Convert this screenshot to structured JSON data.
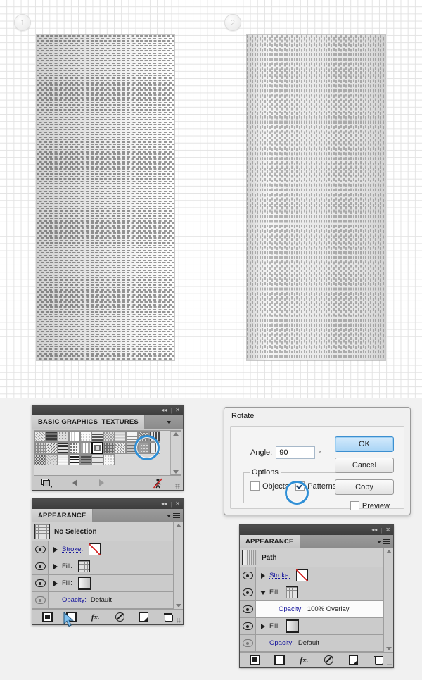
{
  "canvas": {
    "steps": [
      {
        "label": "1",
        "name": "step-badge-1"
      },
      {
        "label": "2",
        "name": "step-badge-2"
      }
    ],
    "artwork": [
      {
        "name": "artwork-original",
        "description": "rectangle filled with horizontal dash texture pattern"
      },
      {
        "name": "artwork-rotated",
        "description": "rectangle filled with dash texture pattern rotated 90 degrees"
      }
    ]
  },
  "swatch_panel": {
    "tab_label": "BASIC GRAPHICS_TEXTURES",
    "titlebar": {
      "collapse": "◂◂",
      "separator": "|",
      "close": "✕"
    },
    "menu_icon": "panel-menu-icon",
    "swatch_count": 29,
    "selected_swatch_index": 16,
    "footer": {
      "library_label": "swatch-libraries-menu",
      "prev_label": "load-previous-swatch-group",
      "next_label": "load-next-swatch-group",
      "break_link_label": "break-link-to-symbol"
    },
    "highlight": "selected pattern swatch ringed in blue"
  },
  "appearance_left": {
    "tab_label": "APPEARANCE",
    "titlebar": {
      "collapse": "◂◂",
      "separator": "|",
      "close": "✕"
    },
    "target_label": "No Selection",
    "rows": [
      {
        "label": "Stroke:",
        "value": "",
        "swatch": "none",
        "expandable": true,
        "visible": true
      },
      {
        "label": "Fill:",
        "value": "",
        "swatch": "pattern-grid",
        "expandable": true,
        "visible": true
      },
      {
        "label": "Fill:",
        "value": "",
        "swatch": "gradient",
        "expandable": true,
        "visible": true
      },
      {
        "label": "Opacity:",
        "value": "Default",
        "swatch": "",
        "expandable": false,
        "visible": true
      }
    ],
    "footer": {
      "add_stroke": "add-new-stroke",
      "add_fill": "add-new-fill",
      "effects": "fx",
      "clear": "clear-appearance",
      "duplicate": "duplicate-selected-item",
      "delete": "delete-selected-item"
    },
    "cursor": "mouse-pointer over add-new-fill button"
  },
  "appearance_right": {
    "tab_label": "APPEARANCE",
    "titlebar": {
      "collapse": "◂◂",
      "separator": "|",
      "close": "✕"
    },
    "target_label": "Path",
    "rows": [
      {
        "label": "Stroke:",
        "value": "",
        "swatch": "none",
        "expandable": true,
        "expanded": false,
        "indent": 0,
        "visible": true
      },
      {
        "label": "Fill:",
        "value": "",
        "swatch": "pattern-grid",
        "expandable": true,
        "expanded": true,
        "indent": 0,
        "visible": true
      },
      {
        "label": "Opacity:",
        "value": "100% Overlay",
        "swatch": "",
        "expandable": false,
        "indent": 1,
        "visible": true
      },
      {
        "label": "Fill:",
        "value": "",
        "swatch": "gradient",
        "expandable": true,
        "expanded": false,
        "indent": 0,
        "visible": true
      },
      {
        "label": "Opacity:",
        "value": "Default",
        "swatch": "",
        "expandable": false,
        "indent": 0,
        "visible": true
      }
    ],
    "footer": {
      "add_stroke": "add-new-stroke",
      "add_fill": "add-new-fill",
      "effects": "fx",
      "clear": "clear-appearance",
      "duplicate": "duplicate-selected-item",
      "delete": "delete-selected-item"
    }
  },
  "rotate_dialog": {
    "title": "Rotate",
    "angle_label": "Angle:",
    "angle_value": "90",
    "degree_symbol": "°",
    "options_legend": "Options",
    "objects_label": "Objects",
    "objects_checked": false,
    "patterns_label": "Patterns",
    "patterns_checked": true,
    "preview_label": "Preview",
    "preview_checked": false,
    "buttons": {
      "ok": "OK",
      "cancel": "Cancel",
      "copy": "Copy"
    },
    "highlight": "Patterns checkbox ringed in blue"
  },
  "colors": {
    "accent": "#2f8fd6",
    "panel_bg": "#d4d4d4",
    "titlebar": "#4a4a4a",
    "link_text": "#13139c",
    "dialog_bg": "#f0f0f0",
    "primary_button": "#a9d4f5"
  }
}
